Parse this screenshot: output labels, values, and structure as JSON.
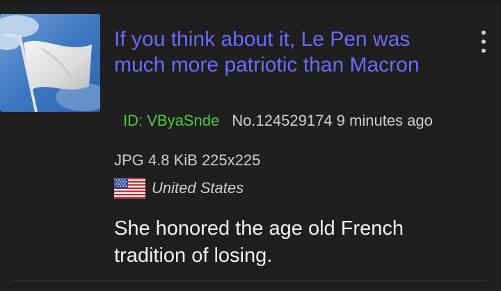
{
  "post": {
    "title": "If you think about it, Le Pen was much more patriotic than Macron",
    "poster_id": "ID: VByaSnde",
    "post_number": "No.124529174",
    "time_ago": "9 minutes ago",
    "file_info": "JPG 4.8 KiB 225x225",
    "country": "United States",
    "comment": "She honored the age old French tradition of losing."
  },
  "icons": {
    "thumbnail": "white-flag-image",
    "menu": "kebab-menu-icon",
    "flag": "us-flag-icon"
  },
  "colors": {
    "background": "#1f1f1f",
    "title": "#6b6bff",
    "poster_id": "#4ccd3a",
    "meta_text": "#cfcfcf",
    "comment_text": "#f2f2f2"
  }
}
